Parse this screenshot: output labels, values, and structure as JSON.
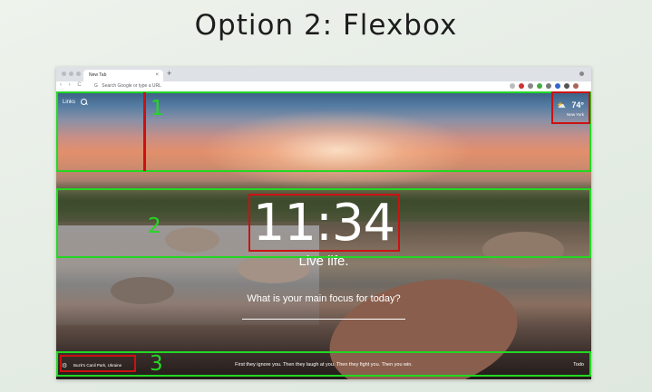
{
  "slide": {
    "title": "Option 2: Flexbox"
  },
  "browser": {
    "tab_title": "New Tab",
    "tab_close": "×",
    "new_tab": "+",
    "nav": "‹ › C",
    "url_placeholder": "Search Google or type a URL",
    "url_icon": "G"
  },
  "dashboard": {
    "links_label": "Links",
    "weather": {
      "icon": "cloud-sun-icon",
      "icon_glyph": "⛅",
      "temp": "74°",
      "city": "New York"
    },
    "clock": "11:34",
    "mantra": "Live life.",
    "focus_prompt": "What is your main focus for today?",
    "photo_location": "Buzk's Canil Park, Ukraine",
    "quote": "First they ignore you. Then they laugh at you. Then they fight you. Then you win.",
    "todo_label": "Todo",
    "settings_icon": "⚙"
  },
  "annotations": {
    "labels": [
      "1",
      "2",
      "3"
    ]
  },
  "colors": {
    "highlight_green": "#22d822",
    "highlight_red": "#cc1111"
  }
}
